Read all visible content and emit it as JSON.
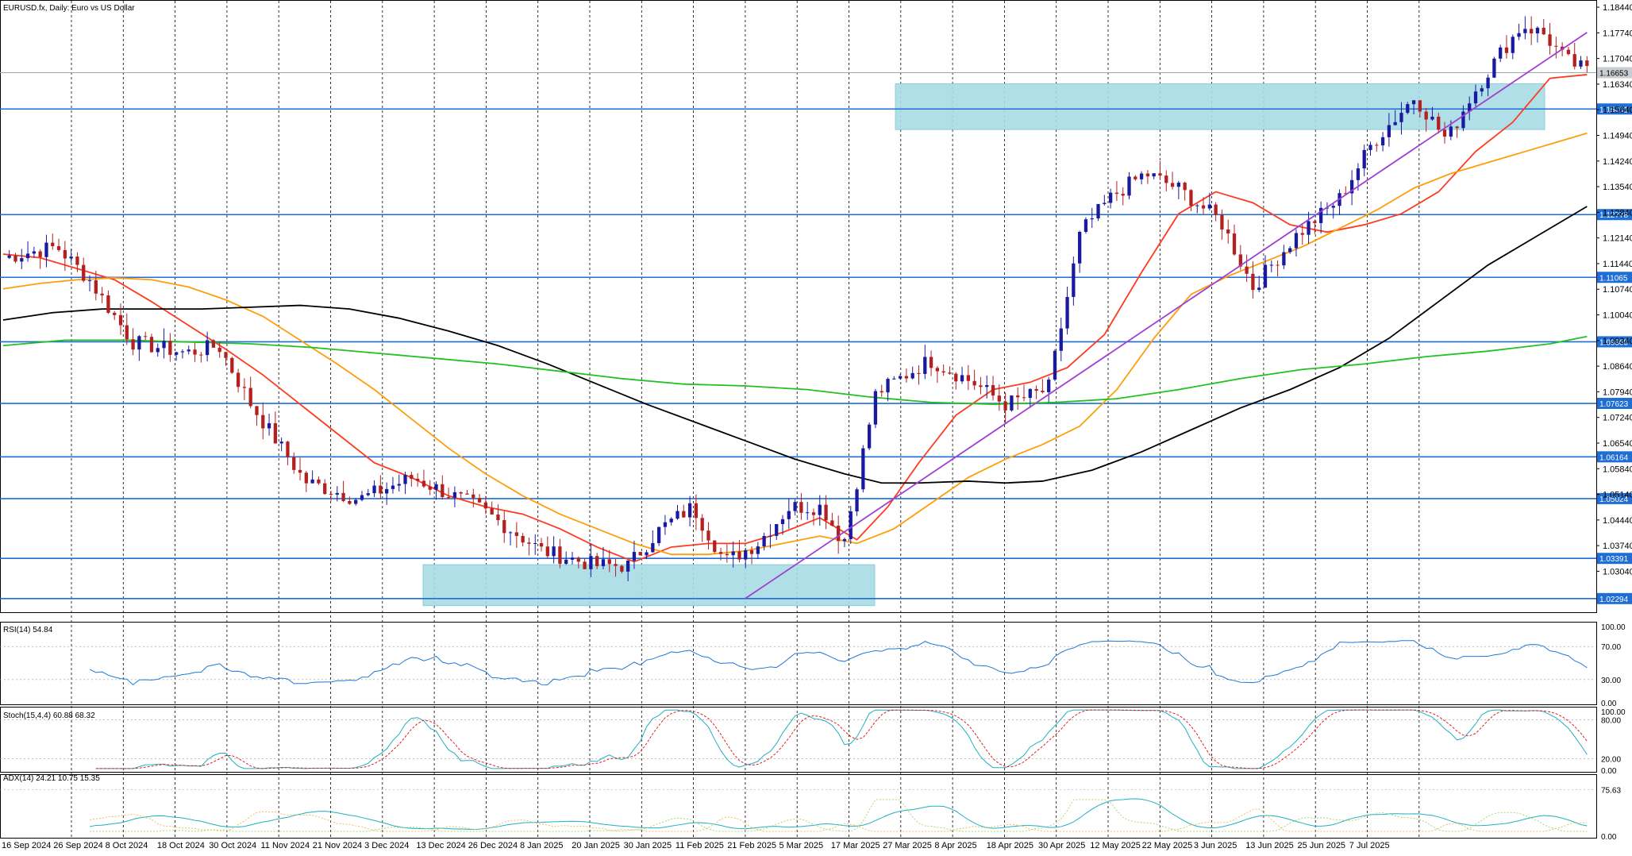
{
  "symbol_title": "EURUSD.fx, Daily: Euro vs US Dollar",
  "chart_data": {
    "type": "candlestick",
    "symbol": "EURUSD.fx",
    "timeframe": "Daily",
    "description": "Euro vs US Dollar",
    "price_axis": {
      "range": [
        1.019,
        1.1855
      ],
      "ticks": [
        "1.18440",
        "1.17740",
        "1.17040",
        "1.16340",
        "1.15640",
        "1.14940",
        "1.14240",
        "1.13540",
        "1.12840",
        "1.12140",
        "1.11440",
        "1.10740",
        "1.10040",
        "1.09340",
        "1.08640",
        "1.07940",
        "1.07240",
        "1.06540",
        "1.05840",
        "1.05140",
        "1.04440",
        "1.03740",
        "1.03040"
      ],
      "current_price": "1.16653"
    },
    "date_labels": [
      "16 Sep 2024",
      "26 Sep 2024",
      "8 Oct 2024",
      "18 Oct 2024",
      "30 Oct 2024",
      "11 Nov 2024",
      "21 Nov 2024",
      "3 Dec 2024",
      "13 Dec 2024",
      "26 Dec 2024",
      "8 Jan 2025",
      "20 Jan 2025",
      "30 Jan 2025",
      "11 Feb 2025",
      "21 Feb 2025",
      "5 Mar 2025",
      "17 Mar 2025",
      "27 Mar 2025",
      "8 Apr 2025",
      "18 Apr 2025",
      "30 Apr 2025",
      "12 May 2025",
      "22 May 2025",
      "3 Jun 2025",
      "13 Jun 2025",
      "25 Jun 2025",
      "7 Jul 2025"
    ],
    "horizontal_levels": [
      "1.15661",
      "1.12778",
      "1.11065",
      "1.09305",
      "1.07623",
      "1.06164",
      "1.05024",
      "1.03391",
      "1.02294"
    ],
    "zones": [
      {
        "from": 1.021,
        "to": 1.0322
      },
      {
        "from": 1.151,
        "to": 1.1635
      }
    ],
    "trendline": [
      {
        "date_index": 120,
        "price": 1.023
      },
      {
        "date_index": 256,
        "price": 1.1775
      }
    ],
    "moving_averages": [
      {
        "color": "#ff3a20",
        "values": [
          [
            0,
            1.117
          ],
          [
            6,
            1.116
          ],
          [
            12,
            1.113
          ],
          [
            18,
            1.11
          ],
          [
            24,
            1.104
          ],
          [
            30,
            1.0975
          ],
          [
            36,
            1.091
          ],
          [
            42,
            1.084
          ],
          [
            48,
            1.076
          ],
          [
            54,
            1.068
          ],
          [
            60,
            1.06
          ],
          [
            66,
            1.056
          ],
          [
            72,
            1.051
          ],
          [
            78,
            1.048
          ],
          [
            84,
            1.046
          ],
          [
            90,
            1.042
          ],
          [
            96,
            1.037
          ],
          [
            102,
            1.033
          ],
          [
            108,
            1.037
          ],
          [
            114,
            1.038
          ],
          [
            120,
            1.038
          ],
          [
            126,
            1.041
          ],
          [
            132,
            1.045
          ],
          [
            138,
            1.039
          ],
          [
            143,
            1.048
          ],
          [
            148,
            1.06
          ],
          [
            154,
            1.073
          ],
          [
            160,
            1.08
          ],
          [
            166,
            1.082
          ],
          [
            172,
            1.086
          ],
          [
            178,
            1.095
          ],
          [
            184,
            1.112
          ],
          [
            190,
            1.128
          ],
          [
            196,
            1.134
          ],
          [
            202,
            1.131
          ],
          [
            208,
            1.125
          ],
          [
            214,
            1.123
          ],
          [
            220,
            1.125
          ],
          [
            226,
            1.128
          ],
          [
            232,
            1.134
          ],
          [
            238,
            1.145
          ],
          [
            244,
            1.153
          ],
          [
            250,
            1.165
          ],
          [
            256,
            1.166
          ]
        ]
      },
      {
        "color": "#ff9e0a",
        "values": [
          [
            0,
            1.1075
          ],
          [
            6,
            1.109
          ],
          [
            12,
            1.11
          ],
          [
            18,
            1.1105
          ],
          [
            24,
            1.11
          ],
          [
            30,
            1.108
          ],
          [
            36,
            1.1045
          ],
          [
            42,
            1.1
          ],
          [
            48,
            1.0935
          ],
          [
            54,
            1.087
          ],
          [
            60,
            1.08
          ],
          [
            66,
            1.072
          ],
          [
            72,
            1.064
          ],
          [
            78,
            1.057
          ],
          [
            84,
            1.051
          ],
          [
            90,
            1.046
          ],
          [
            96,
            1.042
          ],
          [
            102,
            1.038
          ],
          [
            108,
            1.035
          ],
          [
            114,
            1.035
          ],
          [
            120,
            1.036
          ],
          [
            126,
            1.038
          ],
          [
            132,
            1.04
          ],
          [
            138,
            1.038
          ],
          [
            144,
            1.042
          ],
          [
            150,
            1.049
          ],
          [
            156,
            1.056
          ],
          [
            162,
            1.061
          ],
          [
            168,
            1.065
          ],
          [
            174,
            1.07
          ],
          [
            180,
            1.08
          ],
          [
            186,
            1.094
          ],
          [
            192,
            1.106
          ],
          [
            198,
            1.111
          ],
          [
            204,
            1.115
          ],
          [
            210,
            1.119
          ],
          [
            216,
            1.124
          ],
          [
            222,
            1.129
          ],
          [
            228,
            1.135
          ],
          [
            234,
            1.139
          ],
          [
            240,
            1.142
          ],
          [
            246,
            1.145
          ],
          [
            252,
            1.148
          ],
          [
            256,
            1.15
          ]
        ]
      },
      {
        "color": "#000000",
        "values": [
          [
            0,
            1.099
          ],
          [
            8,
            1.101
          ],
          [
            16,
            1.102
          ],
          [
            24,
            1.102
          ],
          [
            32,
            1.102
          ],
          [
            40,
            1.1025
          ],
          [
            48,
            1.103
          ],
          [
            56,
            1.102
          ],
          [
            64,
            1.0995
          ],
          [
            72,
            1.096
          ],
          [
            80,
            1.092
          ],
          [
            88,
            1.087
          ],
          [
            96,
            1.0815
          ],
          [
            104,
            1.076
          ],
          [
            112,
            1.071
          ],
          [
            120,
            1.066
          ],
          [
            128,
            1.061
          ],
          [
            136,
            1.057
          ],
          [
            142,
            1.0545
          ],
          [
            148,
            1.0545
          ],
          [
            156,
            1.055
          ],
          [
            162,
            1.0545
          ],
          [
            168,
            1.055
          ],
          [
            176,
            1.058
          ],
          [
            184,
            1.063
          ],
          [
            192,
            1.069
          ],
          [
            200,
            1.075
          ],
          [
            208,
            1.08
          ],
          [
            216,
            1.086
          ],
          [
            224,
            1.094
          ],
          [
            232,
            1.104
          ],
          [
            240,
            1.114
          ],
          [
            248,
            1.122
          ],
          [
            256,
            1.13
          ]
        ]
      },
      {
        "color": "#22c022",
        "values": [
          [
            0,
            1.092
          ],
          [
            10,
            1.0935
          ],
          [
            20,
            1.0935
          ],
          [
            30,
            1.093
          ],
          [
            40,
            1.0925
          ],
          [
            50,
            1.0915
          ],
          [
            60,
            1.09
          ],
          [
            70,
            1.0885
          ],
          [
            80,
            1.087
          ],
          [
            90,
            1.085
          ],
          [
            100,
            1.083
          ],
          [
            110,
            1.0815
          ],
          [
            120,
            1.081
          ],
          [
            130,
            1.08
          ],
          [
            140,
            1.078
          ],
          [
            150,
            1.0765
          ],
          [
            160,
            1.076
          ],
          [
            170,
            1.0765
          ],
          [
            180,
            1.0775
          ],
          [
            190,
            1.08
          ],
          [
            200,
            1.083
          ],
          [
            210,
            1.0855
          ],
          [
            220,
            1.087
          ],
          [
            230,
            1.089
          ],
          [
            240,
            1.0905
          ],
          [
            250,
            1.0925
          ],
          [
            256,
            1.0945
          ]
        ]
      }
    ]
  },
  "indicators": {
    "rsi": {
      "label": "RSI(14) 54.84",
      "levels": [
        "100.00",
        "70.00",
        "30.00",
        "0.00"
      ]
    },
    "stoch": {
      "label": "Stoch(15,4,4) 60.88 68.32",
      "levels": [
        "100.00",
        "80.00",
        "20.00",
        "0.00"
      ]
    },
    "adx": {
      "label": "ADX(14) 24.21 10.75 15.35",
      "levels": [
        "75.63",
        "0.00"
      ]
    }
  },
  "colors": {
    "bull_candle": "#1a1aa0",
    "bear_candle": "#b32020",
    "level_line": "#1e6ed4",
    "zone_fill": "#a7dce6",
    "trendline": "#a040d0",
    "price_tag_bg": "#1e6ed4",
    "grid": "#000000"
  }
}
